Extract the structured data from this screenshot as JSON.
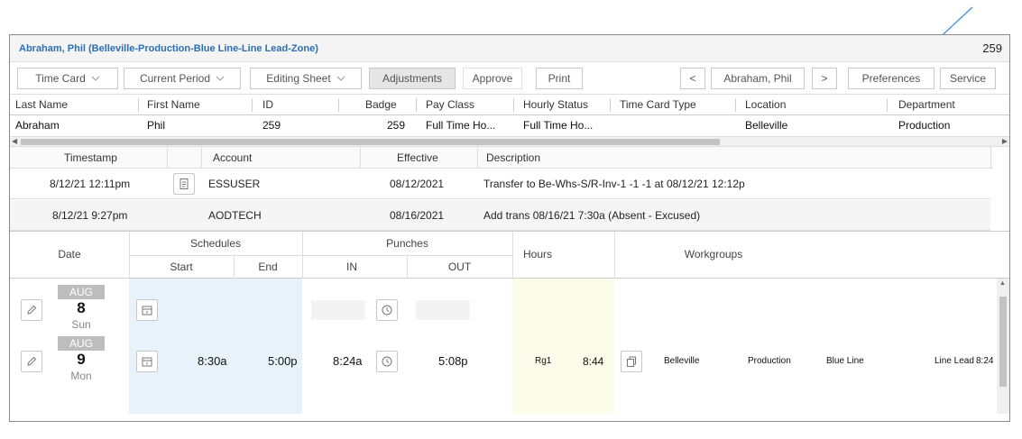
{
  "header": {
    "title": "Abraham, Phil (Belleville-Production-Blue Line-Line Lead-Zone)",
    "id_number": "259"
  },
  "toolbar": {
    "time_card": "Time Card",
    "current_period": "Current Period",
    "editing_sheet": "Editing Sheet",
    "adjustments": "Adjustments",
    "approve": "Approve",
    "print": "Print",
    "prev": "<",
    "employee": "Abraham, Phil",
    "next": ">",
    "preferences": "Preferences",
    "service": "Service"
  },
  "employee_table": {
    "headers": [
      "Last Name",
      "First Name",
      "ID",
      "Badge",
      "Pay Class",
      "Hourly Status",
      "Time Card Type",
      "Location",
      "Department"
    ],
    "row": [
      "Abraham",
      "Phil",
      "259",
      "259",
      "Full Time Ho...",
      "Full Time Ho...",
      "",
      "Belleville",
      "Production"
    ]
  },
  "audit": {
    "headers": {
      "timestamp": "Timestamp",
      "account": "Account",
      "effective": "Effective",
      "description": "Description"
    },
    "rows": [
      {
        "timestamp": "8/12/21 12:11pm",
        "account": "ESSUSER",
        "effective": "08/12/2021",
        "description": "Transfer to Be-Whs-S/R-Inv-1 -1 -1 at 08/12/21 12:12p",
        "icon": "document-icon"
      },
      {
        "timestamp": "8/12/21 9:27pm",
        "account": "AODTECH",
        "effective": "08/16/2021",
        "description": "Add trans 08/16/21 7:30a (Absent - Excused)",
        "icon": ""
      }
    ]
  },
  "grid": {
    "headers": {
      "date": "Date",
      "schedules": "Schedules",
      "start": "Start",
      "end": "End",
      "punches": "Punches",
      "in": "IN",
      "out": "OUT",
      "hours": "Hours",
      "workgroups": "Workgroups"
    },
    "rows": [
      {
        "month": "AUG",
        "day": "8",
        "weekday": "Sun",
        "start": "",
        "end": "",
        "in": "",
        "out": "",
        "pay_code": "",
        "hours": "",
        "workgroups": []
      },
      {
        "month": "AUG",
        "day": "9",
        "weekday": "Mon",
        "start": "8:30a",
        "end": "5:00p",
        "in": "8:24a",
        "out": "5:08p",
        "pay_code": "Rg1",
        "hours": "8:44",
        "workgroups": [
          "Belleville",
          "Production",
          "Blue Line",
          "Line Lead",
          "8:24"
        ]
      }
    ]
  },
  "colors": {
    "title_blue": "#2a6fb5",
    "annotation_arrow": "#4a8fd8",
    "schedule_bg": "#e8f2fb",
    "hours_bg": "#fcfcea"
  }
}
